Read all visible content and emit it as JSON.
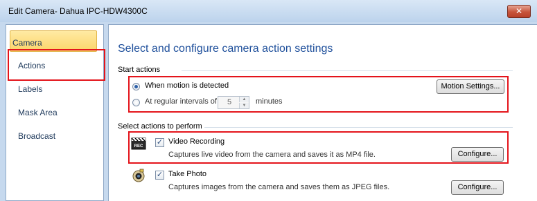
{
  "window": {
    "title": "Edit Camera- Dahua IPC-HDW4300C",
    "close_glyph": "✕"
  },
  "sidebar": {
    "items": [
      {
        "label": "Camera"
      },
      {
        "label": "Actions"
      },
      {
        "label": "Labels"
      },
      {
        "label": "Mask Area"
      },
      {
        "label": "Broadcast"
      }
    ],
    "selected": "Actions"
  },
  "main": {
    "heading": "Select and configure camera action settings",
    "start_actions": {
      "label": "Start actions",
      "option_motion": "When motion is detected",
      "option_interval": "At regular intervals of",
      "interval_value": "5",
      "interval_unit": "minutes",
      "motion_settings_button": "Motion Settings...",
      "selected": "motion"
    },
    "select_actions": {
      "label": "Select actions to perform",
      "video": {
        "title": "Video Recording",
        "description": "Captures live video from the camera and saves it as MP4 file.",
        "configure_button": "Configure...",
        "checked": true,
        "icon": "video-recording-icon"
      },
      "photo": {
        "title": "Take Photo",
        "description": "Captures images from the camera and saves them as JPEG files.",
        "configure_button": "Configure...",
        "checked": true,
        "icon": "camera-photo-icon"
      }
    }
  },
  "colors": {
    "heading": "#1e4f9b",
    "selection": "#fbd56a",
    "highlight_box": "#e4141b",
    "window_bg": "#c6d9ee"
  }
}
